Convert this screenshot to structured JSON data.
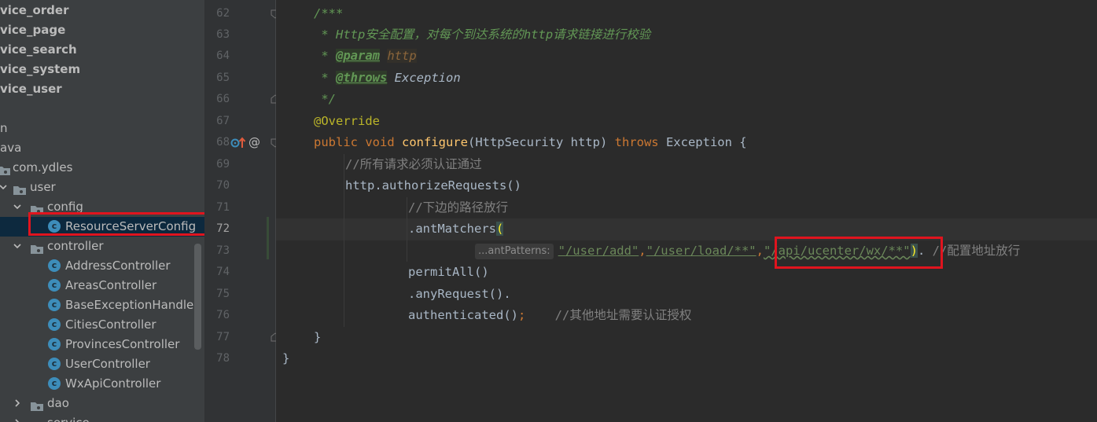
{
  "project_tree": {
    "items": [
      {
        "label": "vice_order",
        "bold": true
      },
      {
        "label": "vice_page",
        "bold": true
      },
      {
        "label": "vice_search",
        "bold": true
      },
      {
        "label": "vice_system",
        "bold": true
      },
      {
        "label": "vice_user",
        "bold": true
      },
      {
        "label": ""
      },
      {
        "label": "n"
      },
      {
        "label": "ava"
      },
      {
        "label": "com.ydles"
      },
      {
        "label": "user"
      },
      {
        "label": "config"
      },
      {
        "label": "ResourceServerConfig"
      },
      {
        "label": "controller"
      },
      {
        "label": "AddressController"
      },
      {
        "label": "AreasController"
      },
      {
        "label": "BaseExceptionHandler"
      },
      {
        "label": "CitiesController"
      },
      {
        "label": "ProvincesController"
      },
      {
        "label": "UserController"
      },
      {
        "label": "WxApiController"
      },
      {
        "label": "dao"
      },
      {
        "label": "service"
      }
    ],
    "class_icon_letter": "c"
  },
  "gutter": {
    "line_numbers": [
      "62",
      "63",
      "64",
      "65",
      "66",
      "67",
      "68",
      "69",
      "70",
      "71",
      "72",
      "73",
      "74",
      "75",
      "76",
      "77",
      "78"
    ],
    "at_icon": "@",
    "icons": [
      "override-up-arrow-icon",
      "lightbulb-icon",
      "fold-icon"
    ]
  },
  "code": {
    "l62": "/***",
    "l63": " * Http安全配置，对每个到达系统的http请求链接进行校验",
    "l64_star": " * ",
    "l64_tag": "@param",
    "l64_val": "http",
    "l65_star": " * ",
    "l65_tag": "@throws",
    "l65_val": " Exception",
    "l66": " */",
    "l67": "@Override",
    "l68_kw1": "public void ",
    "l68_fn": "configure",
    "l68_mid": "(HttpSecurity http) ",
    "l68_kw2": "throws",
    "l68_end": " Exception {",
    "l69": "//所有请求必须认证通过",
    "l70": "http.authorizeRequests()",
    "l71": "//下边的路径放行",
    "l72_a": ".antMatchers",
    "l72_b": "(",
    "l73_hint": "...antPatterns:",
    "l73_s1": "\"/user/add\"",
    "l73_c1": ",",
    "l73_s2": "\"/user/load/**\"",
    "l73_c2": ",",
    "l73_s3": "\"/api/ucenter/wx/**\"",
    "l73_p": ")",
    "l73_dot": ". ",
    "l73_cm": "//配置地址放行",
    "l74": "permitAll()",
    "l75": ".anyRequest().",
    "l76_a": "authenticated()",
    "l76_b": ";",
    "l76_cm": "    //其他地址需要认证授权",
    "l77": "}",
    "l78": "}"
  },
  "colors": {
    "selection_box": "#e0141e",
    "class_icon": "#3d8dba",
    "bulb": "#f0c33c"
  }
}
